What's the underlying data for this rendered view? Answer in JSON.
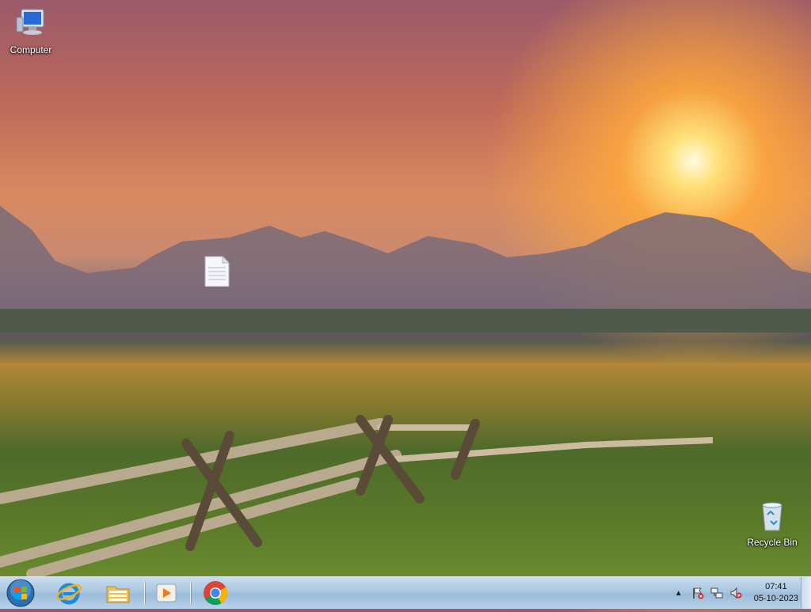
{
  "desktop": {
    "icons": [
      {
        "label": "Computer",
        "icon": "computer-icon"
      },
      {
        "label": "",
        "icon": "document-icon"
      },
      {
        "label": "Recycle Bin",
        "icon": "recycle-bin-icon"
      }
    ]
  },
  "taskbar": {
    "start": {
      "icon": "windows-start-orb"
    },
    "pinned": [
      {
        "icon": "internet-explorer-icon"
      },
      {
        "icon": "file-explorer-icon"
      },
      {
        "icon": "media-player-icon"
      },
      {
        "icon": "chrome-icon"
      }
    ],
    "tray": {
      "icons": [
        "show-hidden-icons-arrow",
        "action-center-flag-icon",
        "network-icon",
        "volume-muted-icon"
      ],
      "time": "07:41",
      "date": "05-10-2023"
    }
  },
  "colors": {
    "taskbar": "#a9c6e0",
    "sun": "#ffe07a"
  }
}
